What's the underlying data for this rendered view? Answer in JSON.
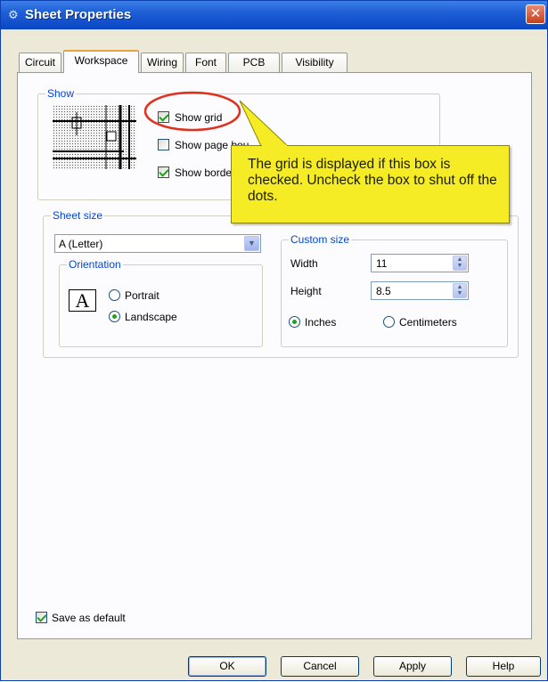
{
  "window": {
    "title": "Sheet Properties",
    "close_glyph": "✕",
    "icon": "gear-icon"
  },
  "tabs": [
    {
      "label": "Circuit"
    },
    {
      "label": "Workspace"
    },
    {
      "label": "Wiring"
    },
    {
      "label": "Font"
    },
    {
      "label": "PCB"
    },
    {
      "label": "Visibility"
    }
  ],
  "show": {
    "group_label": "Show",
    "show_grid": {
      "label": "Show grid",
      "checked": true
    },
    "show_page_bounds": {
      "label": "Show page bou",
      "checked": false
    },
    "show_border": {
      "label": "Show borde",
      "checked": true
    }
  },
  "callout": {
    "text": "The grid is displayed if this box is checked.  Uncheck the box to shut off the dots.",
    "color": "#f5ec25"
  },
  "sheet_size": {
    "group_label": "Sheet size",
    "selected": "A (Letter)",
    "orientation": {
      "group_label": "Orientation",
      "portrait_label": "Portrait",
      "landscape_label": "Landscape",
      "selected": "Landscape",
      "icon_glyph": "A"
    },
    "custom": {
      "group_label": "Custom size",
      "width_label": "Width",
      "width_value": "11",
      "height_label": "Height",
      "height_value": "8.5",
      "inches_label": "Inches",
      "cm_label": "Centimeters",
      "unit_selected": "Inches"
    }
  },
  "save_default": {
    "label": "Save as default",
    "checked": true
  },
  "buttons": {
    "ok": "OK",
    "cancel": "Cancel",
    "apply": "Apply",
    "help": "Help"
  },
  "colors": {
    "accent": "#0046d5",
    "title_bar": "#0a46c4",
    "highlight_circle": "#e0301e"
  }
}
